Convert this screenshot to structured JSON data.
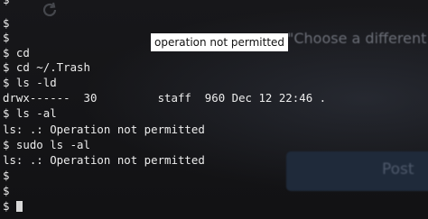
{
  "terminal": {
    "lines": [
      "$",
      "$",
      "$",
      "$ cd",
      "$ cd ~/.Trash",
      "$ ls -ld",
      "drwx------  30         staff  960 Dec 12 22:46 .",
      "$ ls -al",
      "ls: .: Operation not permitted",
      "$ sudo ls -al",
      "ls: .: Operation not permitted",
      "$",
      "$",
      "$"
    ]
  },
  "tooltip": {
    "text": "operation not permitted"
  },
  "background": {
    "heading_fragment": "\"Choose a different t",
    "post_button_label": "Post",
    "refresh_icon": "refresh-icon"
  }
}
